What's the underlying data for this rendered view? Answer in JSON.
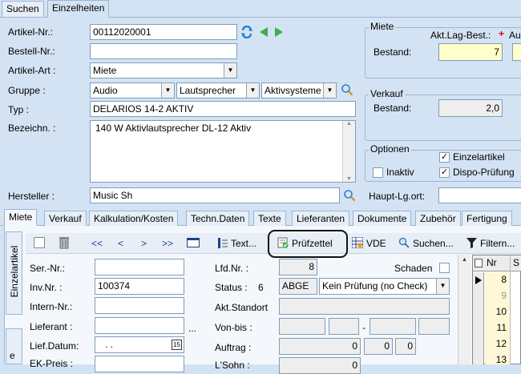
{
  "top_tabs": [
    "Suchen",
    "Einzelheiten"
  ],
  "form": {
    "artikel_nr_label": "Artikel-Nr.:",
    "artikel_nr_value": "00112020001",
    "bestell_nr_label": "Bestell-Nr.:",
    "bestell_nr_value": "",
    "artikel_art_label": "Artikel-Art :",
    "artikel_art_value": "Miete",
    "gruppe_label": "Gruppe :",
    "gruppe_1": "Audio",
    "gruppe_2": "Lautsprecher",
    "gruppe_3": "Aktivsysteme",
    "typ_label": "Typ :",
    "typ_value": "DELARIOS 14-2 AKTIV",
    "bezeichn_label": "Bezeichn. :",
    "bezeichn_value": "140 W Aktivlautsprecher DL-12 Aktiv",
    "hersteller_label": "Hersteller :",
    "hersteller_value": "Music Sh"
  },
  "miete": {
    "title": "Miete",
    "akt_lag_label": "Akt.Lag-Best.:",
    "akt_lag_plus": "+",
    "akt_lag_trunc": "Au",
    "bestand_label": "Bestand:",
    "bestand_value": "7"
  },
  "verkauf": {
    "title": "Verkauf",
    "bestand_label": "Bestand:",
    "bestand_value": "2,0"
  },
  "optionen": {
    "title": "Optionen",
    "einzelartikel": "Einzelartikel",
    "inaktiv": "Inaktiv",
    "dispo": "Dispo-Prüfung"
  },
  "haupt_lg_label": "Haupt-Lg.ort:",
  "tabs": [
    "Miete",
    "Verkauf",
    "Kalkulation/Kosten",
    "Techn.Daten",
    "Texte",
    "Lieferanten",
    "Dokumente",
    "Zubehör",
    "Fertigung"
  ],
  "side_tab": "Einzelartikel",
  "toolbar": {
    "first": "<<",
    "prev": "<",
    "next": ">",
    "last": ">>",
    "text": "Text...",
    "pruefzettel": "Prüfzettel",
    "vde": "VDE",
    "suchen": "Suchen...",
    "filtern": "Filtern..."
  },
  "detail": {
    "ser_nr_label": "Ser.-Nr.:",
    "ser_nr_value": "",
    "inv_nr_label": "Inv.Nr. :",
    "inv_nr_value": "100374",
    "intern_nr_label": "Intern-Nr.:",
    "lieferant_label": "Lieferant :",
    "lieferant_dots": "...",
    "lief_datum_label": "Lief.Datum:",
    "lief_datum_value": ". .",
    "lief_datum_icon_text": "15",
    "ek_preis_label": "EK-Preis :",
    "lfd_nr_label": "Lfd.Nr. :",
    "lfd_nr_value": "8",
    "schaden_label": "Schaden",
    "status_label": "Status :",
    "status_num": "6",
    "status_code": "ABGE",
    "status_text": "Kein Prüfung (no Check)",
    "akt_standort_label": "Akt.Standort",
    "von_bis_label": "Von-bis :",
    "von_bis_sep": "-",
    "auftrag_label": "Auftrag :",
    "auftrag_v1": "0",
    "auftrag_v2": "0",
    "auftrag_v3": "0",
    "lsohn_label": "L'Sohn :",
    "lsohn_v1": "0"
  },
  "grid": {
    "col_nr": "Nr",
    "col_s": "S",
    "rows": [
      "8",
      "9",
      "10",
      "11",
      "12",
      "13"
    ]
  }
}
